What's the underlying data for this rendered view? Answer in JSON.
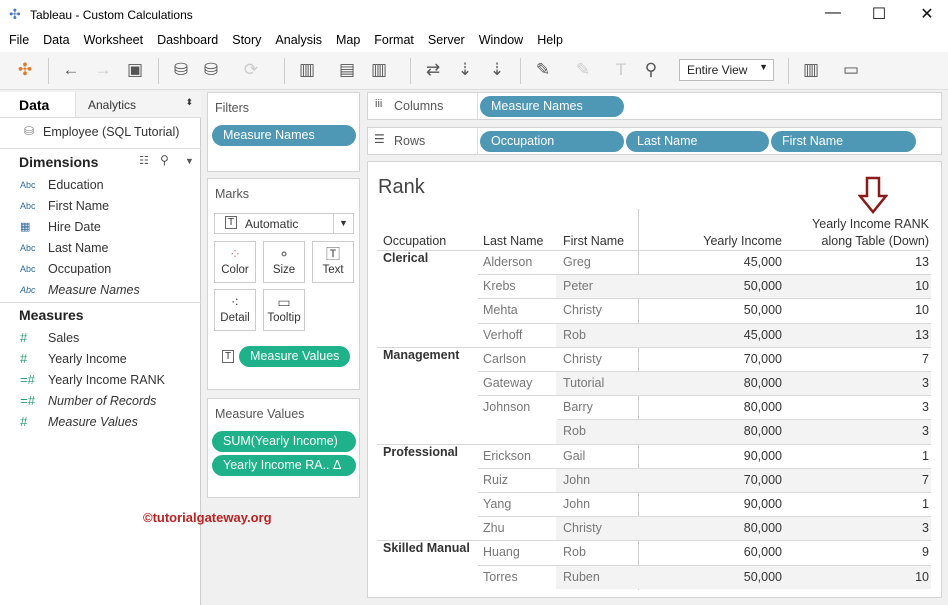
{
  "window": {
    "title": "Tableau - Custom Calculations",
    "min": "—",
    "max": "☐",
    "close": "✕"
  },
  "menu": [
    "File",
    "Data",
    "Worksheet",
    "Dashboard",
    "Story",
    "Analysis",
    "Map",
    "Format",
    "Server",
    "Window",
    "Help"
  ],
  "toolbar": {
    "view_mode": "Entire View"
  },
  "left_panel": {
    "tabs": [
      "Data",
      "Analytics"
    ],
    "datasource": "Employee (SQL Tutorial)",
    "dimensions_title": "Dimensions",
    "dimensions": [
      {
        "icon": "Abc",
        "label": "Education"
      },
      {
        "icon": "Abc",
        "label": "First Name"
      },
      {
        "icon": "calendar",
        "label": "Hire Date"
      },
      {
        "icon": "Abc",
        "label": "Last Name"
      },
      {
        "icon": "Abc",
        "label": "Occupation"
      },
      {
        "icon": "Abc",
        "label": "Measure Names"
      }
    ],
    "measures_title": "Measures",
    "measures": [
      {
        "icon": "#",
        "label": "Sales"
      },
      {
        "icon": "#",
        "label": "Yearly Income"
      },
      {
        "icon": "=#",
        "label": "Yearly Income RANK"
      },
      {
        "icon": "=#",
        "label": "Number of Records"
      },
      {
        "icon": "#",
        "label": "Measure Values"
      }
    ]
  },
  "filters": {
    "title": "Filters",
    "pills": [
      "Measure Names"
    ]
  },
  "marks": {
    "title": "Marks",
    "type": "Automatic",
    "buttons": [
      "Color",
      "Size",
      "Text",
      "Detail",
      "Tooltip"
    ],
    "text_pill": "Measure Values"
  },
  "measure_values": {
    "title": "Measure Values",
    "pills": [
      "SUM(Yearly Income)",
      "Yearly Income RA.. Δ"
    ]
  },
  "shelves": {
    "columns_label": "Columns",
    "columns": [
      "Measure Names"
    ],
    "rows_label": "Rows",
    "rows": [
      "Occupation",
      "Last Name",
      "First Name"
    ]
  },
  "view": {
    "title": "Rank",
    "watermark": "©tutorialgateway.org",
    "arrow_color": "#8b1a1a",
    "headers": [
      "Occupation",
      "Last Name",
      "First Name",
      "Yearly Income",
      "Yearly Income RANK",
      "along Table (Down)"
    ],
    "rows": [
      [
        "Clerical",
        "Alderson",
        "Greg",
        "45,000",
        "13"
      ],
      [
        "",
        "Krebs",
        "Peter",
        "50,000",
        "10"
      ],
      [
        "",
        "Mehta",
        "Christy",
        "50,000",
        "10"
      ],
      [
        "",
        "Verhoff",
        "Rob",
        "45,000",
        "13"
      ],
      [
        "Management",
        "Carlson",
        "Christy",
        "70,000",
        "7"
      ],
      [
        "",
        "Gateway",
        "Tutorial",
        "80,000",
        "3"
      ],
      [
        "",
        "Johnson",
        "Barry",
        "80,000",
        "3"
      ],
      [
        "",
        "",
        "Rob",
        "80,000",
        "3"
      ],
      [
        "Professional",
        "Erickson",
        "Gail",
        "90,000",
        "1"
      ],
      [
        "",
        "Ruiz",
        "John",
        "70,000",
        "7"
      ],
      [
        "",
        "Yang",
        "John",
        "90,000",
        "1"
      ],
      [
        "",
        "Zhu",
        "Christy",
        "80,000",
        "3"
      ],
      [
        "Skilled Manual",
        "Huang",
        "Rob",
        "60,000",
        "9"
      ],
      [
        "",
        "Torres",
        "Ruben",
        "50,000",
        "10"
      ]
    ]
  }
}
